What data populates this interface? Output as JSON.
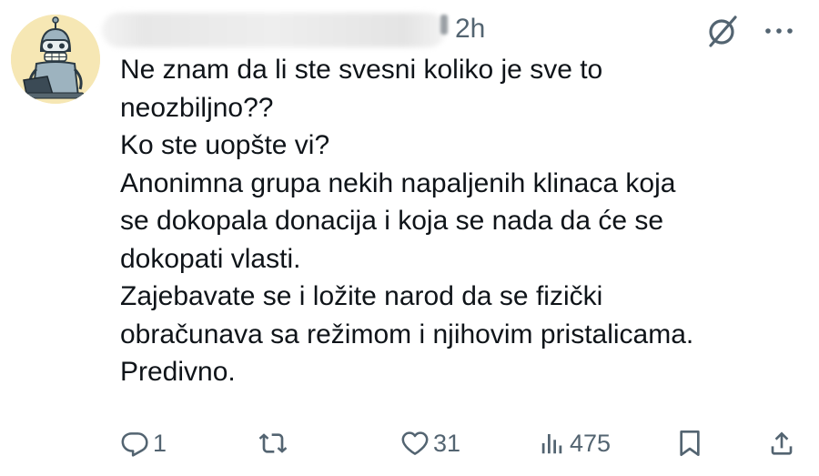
{
  "tweet": {
    "time": "2h",
    "text_lines": [
      "Ne znam da li ste svesni koliko je sve to",
      "neozbiljno??",
      "Ko ste uopšte vi?",
      "Anonimna grupa nekih napaljenih klinaca koja",
      "se dokopala donacija i koja se nada da će se",
      "dokopati vlasti.",
      "Zajebavate se i ložite narod da se fizički",
      "obračunava sa režimom i njihovim pristalicama.",
      "Predivno."
    ]
  },
  "actions": {
    "reply": {
      "icon": "reply-icon",
      "count": "1"
    },
    "retweet": {
      "icon": "retweet-icon",
      "count": ""
    },
    "like": {
      "icon": "heart-icon",
      "count": "31"
    },
    "views": {
      "icon": "views-icon",
      "count": "475"
    },
    "bookmark": {
      "icon": "bookmark-icon"
    },
    "share": {
      "icon": "share-icon"
    }
  },
  "colors": {
    "text": "#0f1419",
    "secondary": "#536471",
    "avatar_bg": "#f6e7b4"
  }
}
